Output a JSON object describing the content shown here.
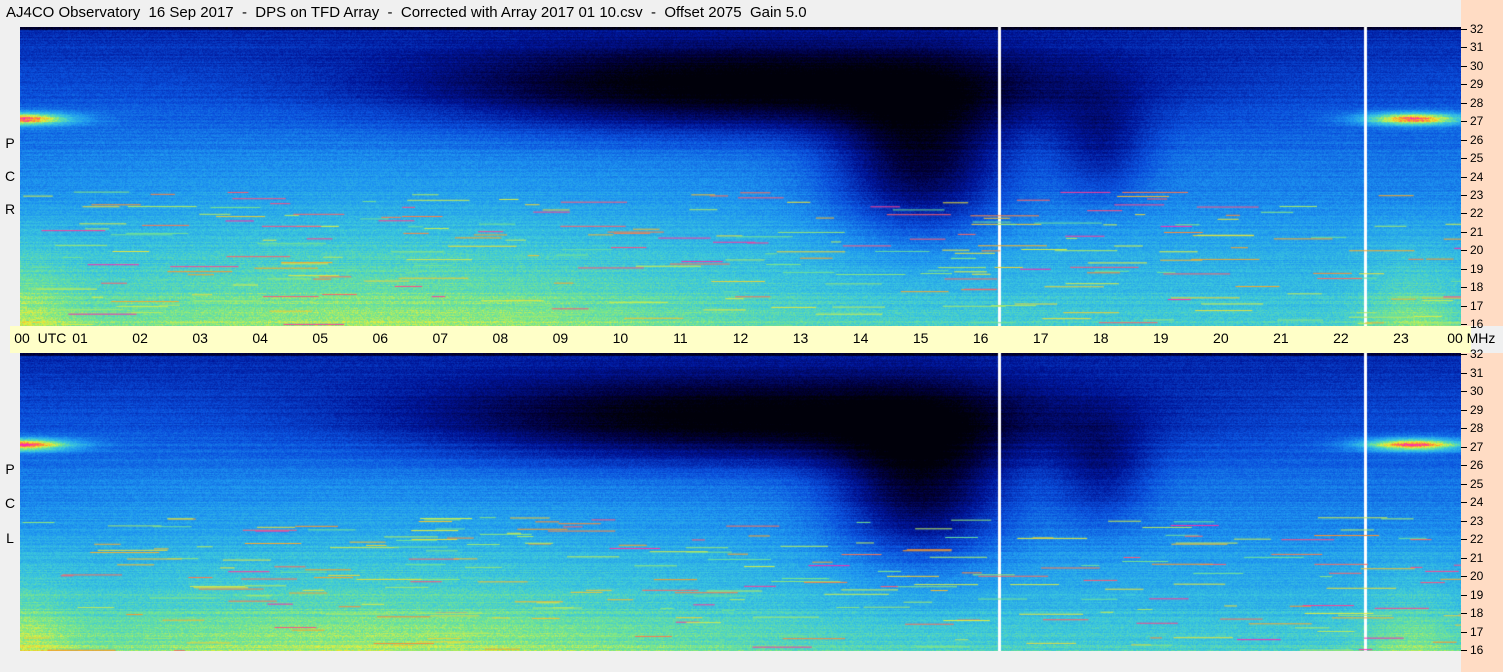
{
  "title": "AJ4CO Observatory  16 Sep 2017  -  DPS on TFD Array  -  Corrected with Array 2017 01 10.csv  -  Offset 2075  Gain 5.0",
  "rcp_label": [
    "R",
    "C",
    "P"
  ],
  "lcp_label": [
    "L",
    "C",
    "P"
  ],
  "time_axis": {
    "labels": [
      "00",
      "UTC",
      "01",
      "02",
      "03",
      "04",
      "05",
      "06",
      "07",
      "08",
      "09",
      "10",
      "11",
      "12",
      "13",
      "14",
      "15",
      "16",
      "17",
      "18",
      "19",
      "20",
      "21",
      "22",
      "23",
      "00",
      "MHz"
    ]
  },
  "freq_axis": {
    "labels": [
      "32",
      "31",
      "30",
      "29",
      "28",
      "27",
      "26",
      "25",
      "24",
      "23",
      "22",
      "21",
      "20",
      "19",
      "18",
      "17",
      "16"
    ]
  },
  "chart_data": [
    {
      "type": "heatmap",
      "title": "RCP",
      "x_range_utc_hours": [
        0,
        24
      ],
      "y_range_mhz": [
        16,
        32
      ],
      "gaps_utc_hours": [
        16.3,
        22.4
      ]
    },
    {
      "type": "heatmap",
      "title": "LCP",
      "x_range_utc_hours": [
        0,
        24
      ],
      "y_range_mhz": [
        16,
        32
      ],
      "gaps_utc_hours": [
        16.3,
        22.4
      ]
    }
  ]
}
